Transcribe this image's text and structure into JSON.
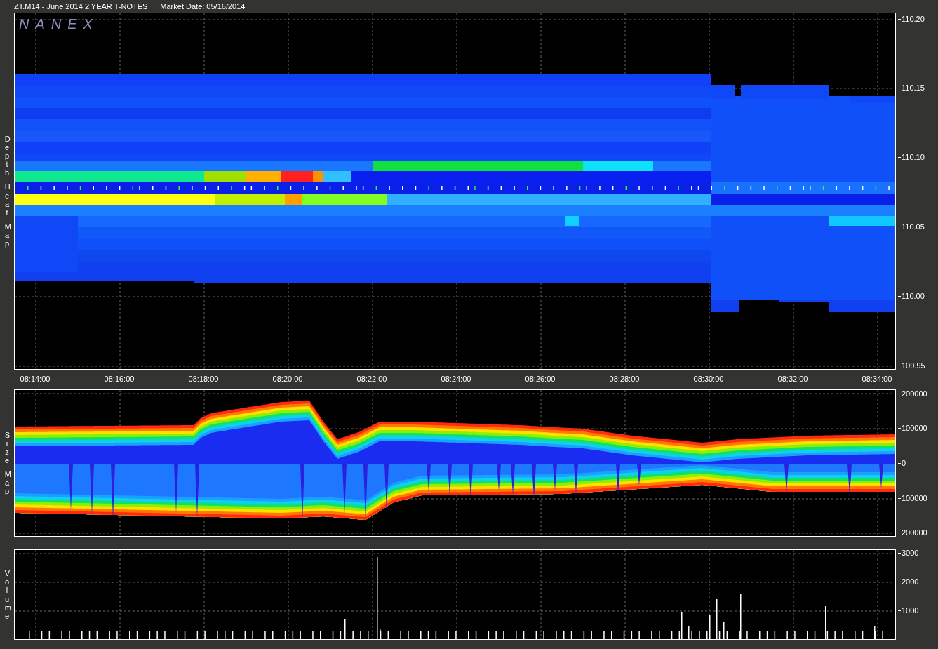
{
  "header": {
    "symbol": "ZT.M14 - June 2014 2 YEAR T-NOTES",
    "market_date": "Market Date: 05/16/2014"
  },
  "depth_panel": {
    "axis_title": "Depth Heat Map",
    "watermark": "NANEX",
    "yticks": [
      "110.20",
      "110.15",
      "110.10",
      "110.05",
      "110.00",
      "109.95"
    ]
  },
  "time_axis": {
    "labels": [
      "08:14:00",
      "08:16:00",
      "08:18:00",
      "08:20:00",
      "08:22:00",
      "08:24:00",
      "08:26:00",
      "08:28:00",
      "08:30:00",
      "08:32:00",
      "08:34:00"
    ]
  },
  "size_panel": {
    "axis_title": "Size Map",
    "yticks": [
      "200000",
      "100000",
      "0",
      "100000",
      "200000"
    ]
  },
  "volume_panel": {
    "axis_title": "Volume",
    "yticks": [
      "3000",
      "2000",
      "1000"
    ]
  }
}
